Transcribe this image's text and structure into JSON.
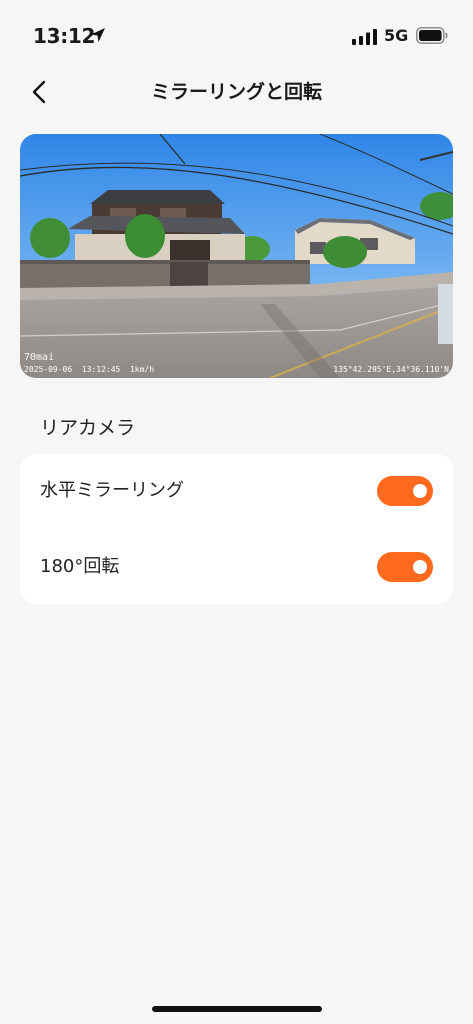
{
  "status_bar": {
    "time": "13:12",
    "network": "5G",
    "icons": [
      "location-arrow-icon",
      "signal-icon",
      "battery-icon"
    ]
  },
  "header": {
    "back_icon": "chevron-left-icon",
    "title": "ミラーリングと回転"
  },
  "preview": {
    "watermark_brand": "70mai",
    "watermark_datetime": "2025-09-06  13:12:45  1km/h",
    "watermark_gps": "135°42.295'E,34°36.110'N"
  },
  "section": {
    "title": "リアカメラ",
    "settings": [
      {
        "label": "水平ミラーリング",
        "enabled": true
      },
      {
        "label": "180°回転",
        "enabled": true
      }
    ]
  },
  "colors": {
    "accent": "#ff6a1f",
    "background": "#f6f6f6",
    "card": "#ffffff"
  }
}
